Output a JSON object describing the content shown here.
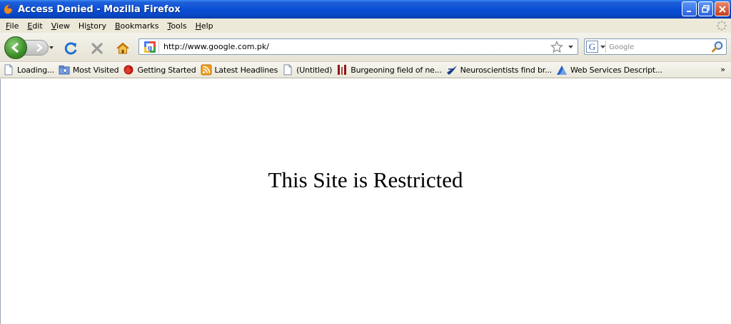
{
  "window": {
    "title": "Access Denied - Mozilla Firefox"
  },
  "menu": {
    "items": [
      {
        "accel": "F",
        "rest": "ile"
      },
      {
        "accel": "E",
        "rest": "dit"
      },
      {
        "accel": "V",
        "rest": "iew"
      },
      {
        "accel": "",
        "pre": "Hi",
        "accel2": "s",
        "rest": "tory"
      },
      {
        "accel": "B",
        "rest": "ookmarks"
      },
      {
        "accel": "T",
        "rest": "ools"
      },
      {
        "accel": "H",
        "rest": "elp"
      }
    ]
  },
  "nav": {
    "url": "http://www.google.com.pk/",
    "search_placeholder": "Google"
  },
  "bookmarks": {
    "items": [
      {
        "label": "Loading...",
        "icon": "page-icon"
      },
      {
        "label": "Most Visited",
        "icon": "folder-icon"
      },
      {
        "label": "Getting Started",
        "icon": "firefox-icon"
      },
      {
        "label": "Latest Headlines",
        "icon": "rss-icon"
      },
      {
        "label": "(Untitled)",
        "icon": "page-icon"
      },
      {
        "label": "Burgeoning field of ne...",
        "icon": "site-icon"
      },
      {
        "label": "Neuroscientists find br...",
        "icon": "site-icon"
      },
      {
        "label": "Web Services Descript...",
        "icon": "site-icon"
      }
    ],
    "overflow": "»"
  },
  "content": {
    "heading": "This Site is Restricted"
  },
  "colors": {
    "titlebar": "#0a4fd6",
    "chrome": "#ece9d8"
  }
}
